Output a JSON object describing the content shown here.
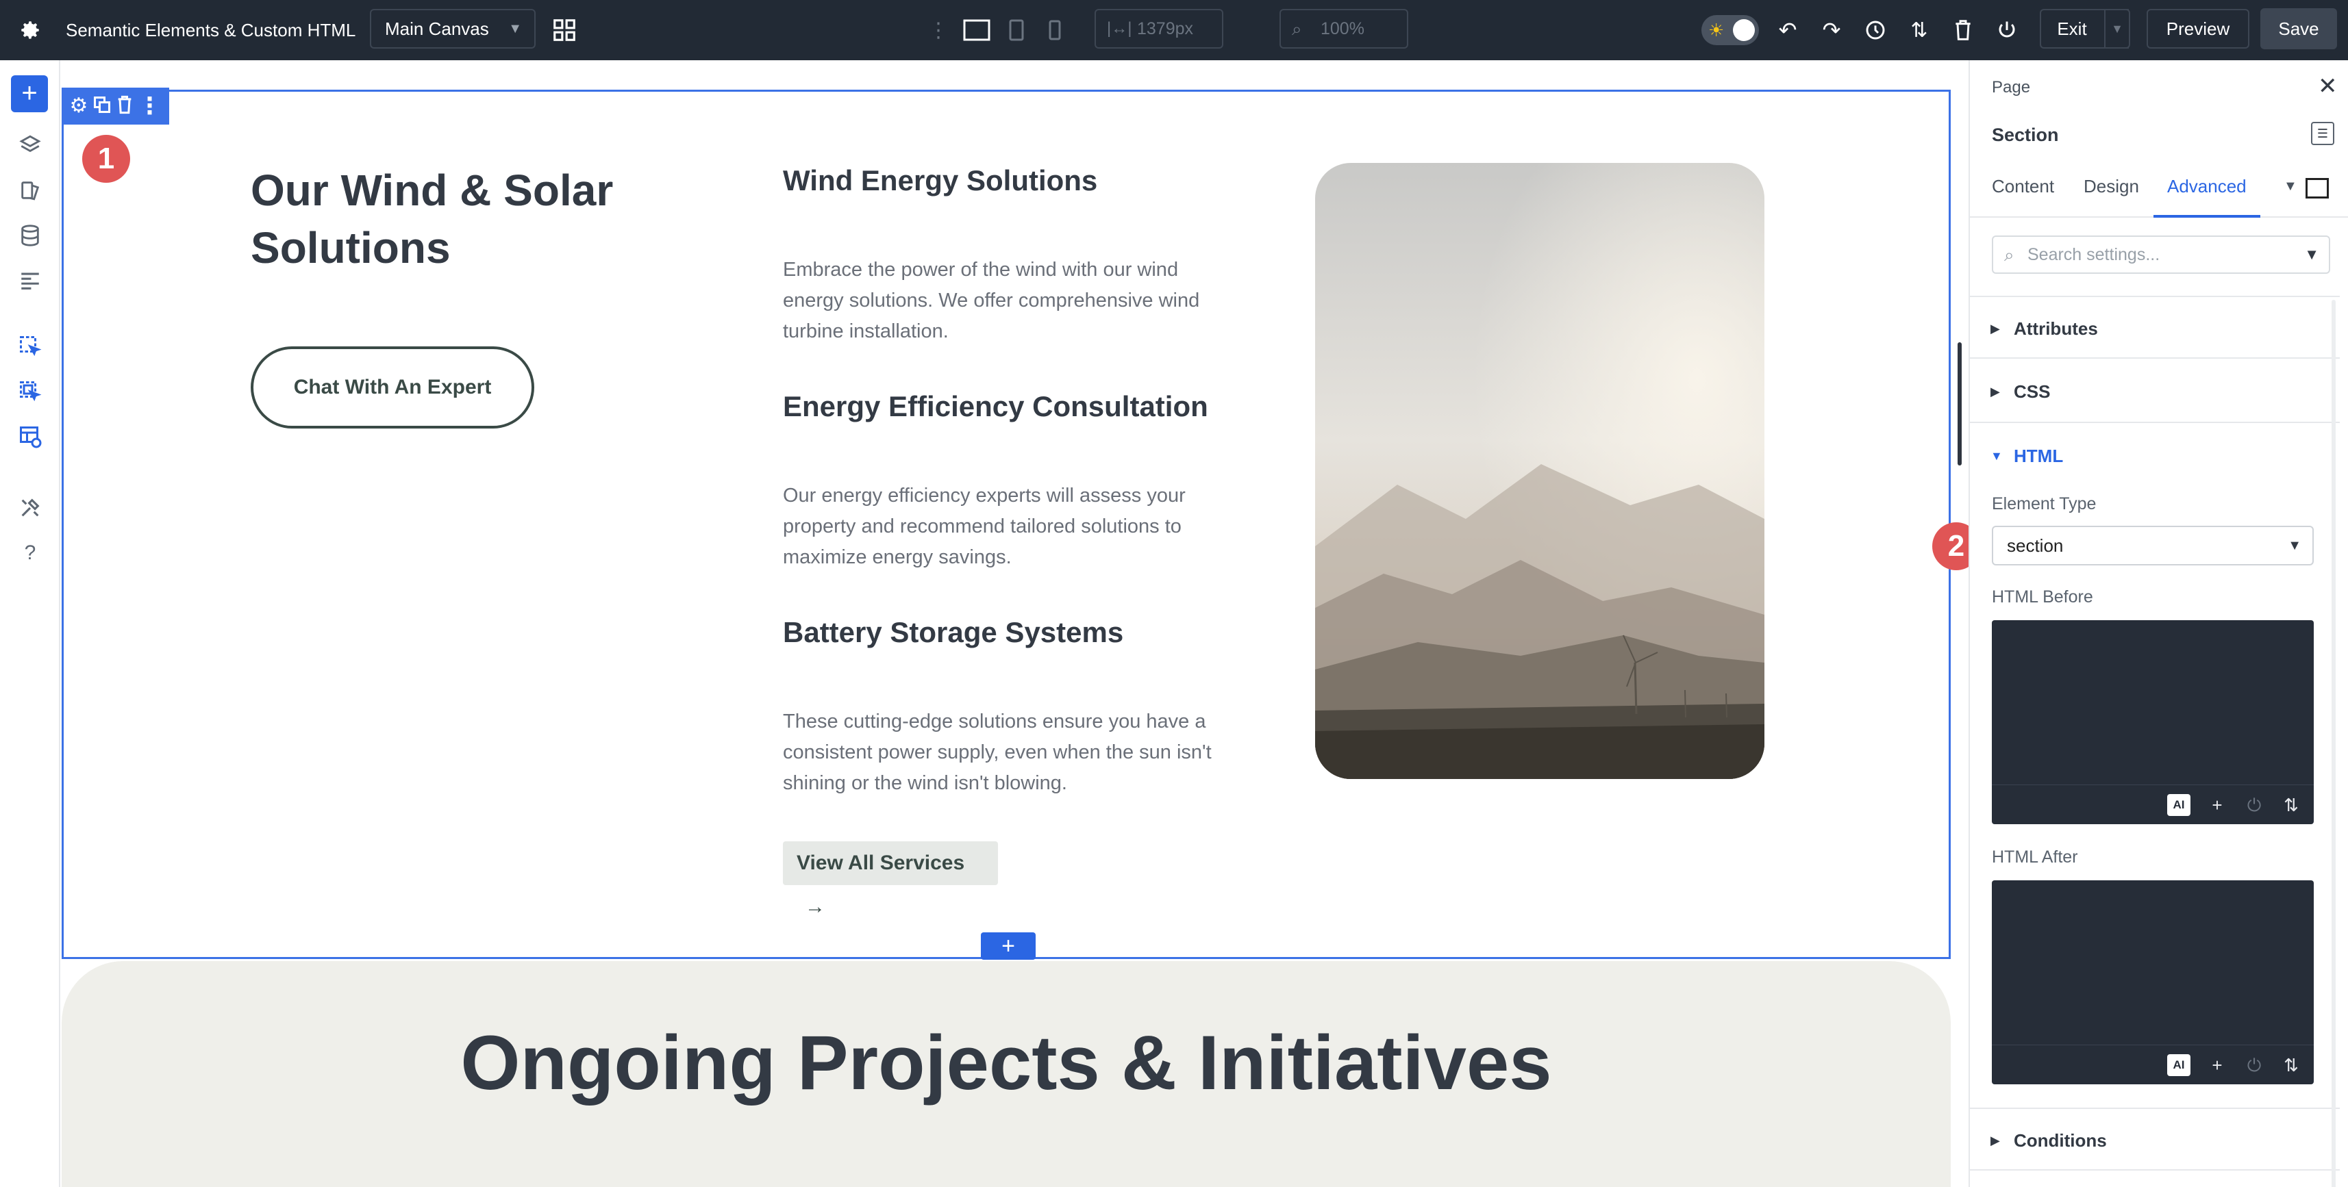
{
  "topbar": {
    "title": "Semantic Elements & Custom HTML",
    "canvas_select": "Main Canvas",
    "width_value": "1379px",
    "zoom_value": "100%",
    "exit_label": "Exit",
    "preview_label": "Preview",
    "save_label": "Save"
  },
  "canvas": {
    "section_marker": "1",
    "heading": "Our Wind & Solar Solutions",
    "chat_button": "Chat With An Expert",
    "services": [
      {
        "title": "Wind Energy Solutions",
        "desc": "Embrace the power of the wind with our wind energy solutions. We offer comprehensive wind turbine installation."
      },
      {
        "title": "Energy Efficiency Consultation",
        "desc": "Our energy efficiency experts will assess your property and recommend tailored solutions to maximize energy savings."
      },
      {
        "title": "Battery Storage Systems",
        "desc": "These cutting-edge solutions ensure you have a consistent power supply, even when the sun isn't shining or the wind isn't blowing."
      }
    ],
    "view_all_button": "View All Services",
    "view_all_arrow": "→",
    "add_button": "+",
    "next_heading": "Ongoing Projects & Initiatives"
  },
  "panel": {
    "breadcrumb": "Page",
    "element": "Section",
    "tabs": [
      "Content",
      "Design",
      "Advanced"
    ],
    "active_tab": "Advanced",
    "search_placeholder": "Search settings...",
    "accordions": {
      "attributes": "Attributes",
      "css": "CSS",
      "html": "HTML",
      "conditions": "Conditions"
    },
    "element_type_label": "Element Type",
    "element_type_value": "section",
    "html_before_label": "HTML Before",
    "html_after_label": "HTML After",
    "ai_label": "AI",
    "marker": "2"
  },
  "colors": {
    "accent": "#2b66e3",
    "topbar": "#222a35",
    "marker": "#e05555"
  }
}
